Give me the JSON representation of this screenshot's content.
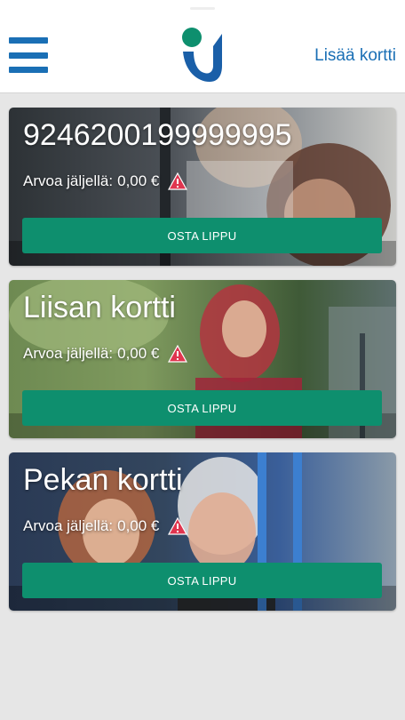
{
  "header": {
    "menu_icon": "hamburger-menu-icon",
    "logo_icon": "app-logo",
    "add_card_label": "Lisää kortti",
    "accent_color": "#1a6fb5"
  },
  "cards": [
    {
      "title": "9246200199999995",
      "balance_label": "Arvoa jäljellä:",
      "balance_value": "0,00 €",
      "warning_icon": "warning-triangle-icon",
      "button_label": "OSTA LIPPU"
    },
    {
      "title": "Liisan kortti",
      "balance_label": "Arvoa jäljellä:",
      "balance_value": "0,00 €",
      "warning_icon": "warning-triangle-icon",
      "button_label": "OSTA LIPPU"
    },
    {
      "title": "Pekan kortti",
      "balance_label": "Arvoa jäljellä:",
      "balance_value": "0,00 €",
      "warning_icon": "warning-triangle-icon",
      "button_label": "OSTA LIPPU"
    }
  ],
  "colors": {
    "button": "#0e8f6e",
    "warning": "#e0354f",
    "background": "#e6e6e6"
  }
}
